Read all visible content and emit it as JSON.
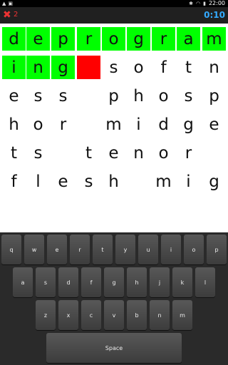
{
  "status_bar": {
    "time": "22:00"
  },
  "action_bar": {
    "mistake_count": "2",
    "timer": "0:10"
  },
  "board": {
    "rows": [
      [
        {
          "ch": "d",
          "state": "green"
        },
        {
          "ch": "e",
          "state": "green"
        },
        {
          "ch": "p",
          "state": "green"
        },
        {
          "ch": "r",
          "state": "green"
        },
        {
          "ch": "o",
          "state": "green"
        },
        {
          "ch": "g",
          "state": "green"
        },
        {
          "ch": "r",
          "state": "green"
        },
        {
          "ch": "a",
          "state": "green"
        },
        {
          "ch": "m",
          "state": "green"
        }
      ],
      [
        {
          "ch": "i",
          "state": "green"
        },
        {
          "ch": "n",
          "state": "green"
        },
        {
          "ch": "g",
          "state": "green"
        },
        {
          "ch": "",
          "state": "red"
        },
        {
          "ch": "s",
          "state": "none"
        },
        {
          "ch": "o",
          "state": "none"
        },
        {
          "ch": "f",
          "state": "none"
        },
        {
          "ch": "t",
          "state": "none"
        },
        {
          "ch": "n",
          "state": "none"
        }
      ],
      [
        {
          "ch": "e",
          "state": "none"
        },
        {
          "ch": "s",
          "state": "none"
        },
        {
          "ch": "s",
          "state": "none"
        },
        {
          "ch": "",
          "state": "none"
        },
        {
          "ch": "p",
          "state": "none"
        },
        {
          "ch": "h",
          "state": "none"
        },
        {
          "ch": "o",
          "state": "none"
        },
        {
          "ch": "s",
          "state": "none"
        },
        {
          "ch": "p",
          "state": "none"
        }
      ],
      [
        {
          "ch": "h",
          "state": "none"
        },
        {
          "ch": "o",
          "state": "none"
        },
        {
          "ch": "r",
          "state": "none"
        },
        {
          "ch": "",
          "state": "none"
        },
        {
          "ch": "m",
          "state": "none"
        },
        {
          "ch": "i",
          "state": "none"
        },
        {
          "ch": "d",
          "state": "none"
        },
        {
          "ch": "g",
          "state": "none"
        },
        {
          "ch": "e",
          "state": "none"
        }
      ],
      [
        {
          "ch": "t",
          "state": "none"
        },
        {
          "ch": "s",
          "state": "none"
        },
        {
          "ch": "",
          "state": "none"
        },
        {
          "ch": "t",
          "state": "none"
        },
        {
          "ch": "e",
          "state": "none"
        },
        {
          "ch": "n",
          "state": "none"
        },
        {
          "ch": "o",
          "state": "none"
        },
        {
          "ch": "r",
          "state": "none"
        },
        {
          "ch": "",
          "state": "none"
        }
      ],
      [
        {
          "ch": "f",
          "state": "none"
        },
        {
          "ch": "l",
          "state": "none"
        },
        {
          "ch": "e",
          "state": "none"
        },
        {
          "ch": "s",
          "state": "none"
        },
        {
          "ch": "h",
          "state": "none"
        },
        {
          "ch": "",
          "state": "none"
        },
        {
          "ch": "m",
          "state": "none"
        },
        {
          "ch": "i",
          "state": "none"
        },
        {
          "ch": "g",
          "state": "none"
        }
      ]
    ]
  },
  "keyboard": {
    "row1": [
      "q",
      "w",
      "e",
      "r",
      "t",
      "y",
      "u",
      "i",
      "o",
      "p"
    ],
    "row2": [
      "a",
      "s",
      "d",
      "f",
      "g",
      "h",
      "j",
      "k",
      "l"
    ],
    "row3": [
      "z",
      "x",
      "c",
      "v",
      "b",
      "n",
      "m"
    ],
    "space_label": "Space"
  }
}
